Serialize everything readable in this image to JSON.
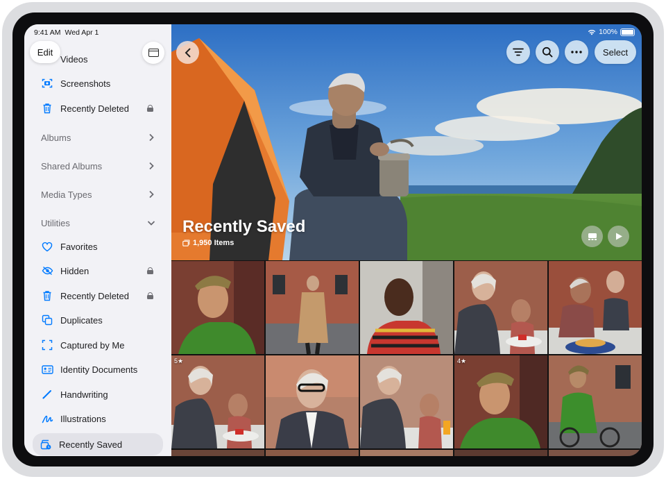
{
  "status_bar": {
    "time": "9:41 AM",
    "date": "Wed Apr 1",
    "battery": "100%"
  },
  "sidebar": {
    "edit_label": "Edit",
    "items_top": [
      {
        "label": "Videos",
        "icon": "video-icon"
      },
      {
        "label": "Screenshots",
        "icon": "screenshot-icon"
      },
      {
        "label": "Recently Deleted",
        "icon": "trash-icon",
        "locked": true
      }
    ],
    "sections": [
      {
        "label": "Albums",
        "state": "collapsed"
      },
      {
        "label": "Shared Albums",
        "state": "collapsed"
      },
      {
        "label": "Media Types",
        "state": "collapsed"
      },
      {
        "label": "Utilities",
        "state": "expanded"
      }
    ],
    "utilities": [
      {
        "label": "Favorites",
        "icon": "heart-icon"
      },
      {
        "label": "Hidden",
        "icon": "eye-slash-icon",
        "locked": true
      },
      {
        "label": "Recently Deleted",
        "icon": "trash-icon",
        "locked": true
      },
      {
        "label": "Duplicates",
        "icon": "duplicates-icon"
      },
      {
        "label": "Captured by Me",
        "icon": "viewfinder-icon"
      },
      {
        "label": "Identity Documents",
        "icon": "id-card-icon"
      },
      {
        "label": "Handwriting",
        "icon": "pen-icon"
      },
      {
        "label": "Illustrations",
        "icon": "scribble-icon"
      },
      {
        "label": "Recently Saved",
        "icon": "recently-saved-icon",
        "selected": true
      }
    ]
  },
  "header": {
    "select_label": "Select"
  },
  "hero": {
    "title": "Recently Saved",
    "subtitle": "1,950 Items"
  },
  "grid": {
    "badges": [
      {
        "cell": 5,
        "text": "5★"
      },
      {
        "cell": 8,
        "text": "4★"
      }
    ]
  },
  "colors": {
    "accent": "#007aff",
    "sidebar_bg": "#f2f2f6",
    "selected_bg": "#e2e2e8"
  }
}
